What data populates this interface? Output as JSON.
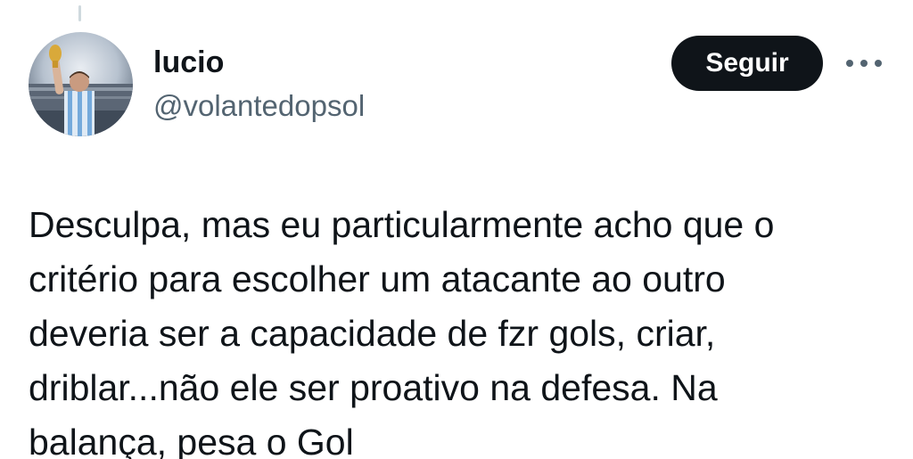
{
  "author": {
    "display_name": "lucio",
    "handle": "@volantedopsol"
  },
  "actions": {
    "follow_label": "Seguir",
    "more_icon": "more-horizontal-icon"
  },
  "tweet": {
    "text": "Desculpa, mas eu particularmente acho que o\ncritério para escolher um atacante ao outro\ndeveria ser a capacidade de fzr gols, criar,\ndriblar...não ele ser proativo na defesa. Na\nbalança, pesa o Gol"
  },
  "colors": {
    "text_primary": "#0f1419",
    "text_secondary": "#536471",
    "follow_button_bg": "#0f1419",
    "follow_button_text": "#ffffff",
    "background": "#ffffff"
  }
}
